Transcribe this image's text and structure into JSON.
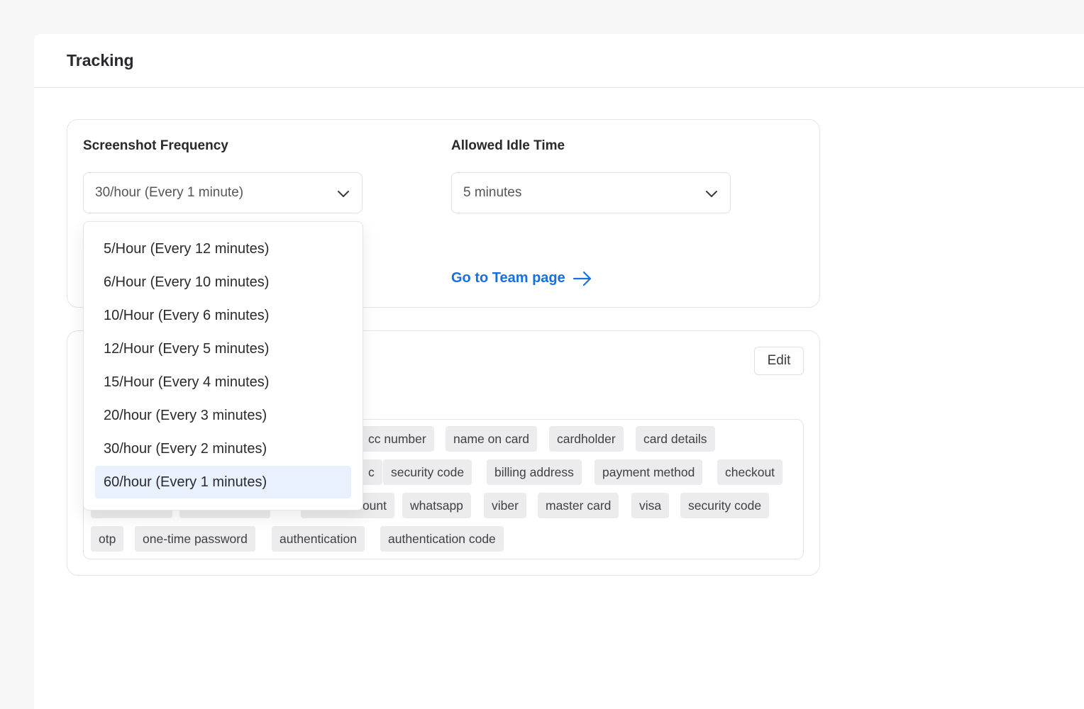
{
  "page": {
    "title": "Tracking"
  },
  "screenshot_frequency": {
    "label": "Screenshot Frequency",
    "value": "30/hour (Every 1 minute)",
    "icon": "chevron-down-icon",
    "options": [
      "5/Hour (Every 12 minutes)",
      "6/Hour (Every 10 minutes)",
      "10/Hour (Every 6 minutes)",
      "12/Hour (Every 5 minutes)",
      "15/Hour (Every 4 minutes)",
      "20/hour (Every 3 minutes)",
      "30/hour (Every 2 minutes)",
      "60/hour (Every 1 minutes)"
    ],
    "highlighted_option": "60/hour (Every 1 minutes)"
  },
  "idle_time": {
    "label": "Allowed Idle Time",
    "value": "5 minutes",
    "icon": "chevron-down-icon"
  },
  "team_link": {
    "label": "Go to Team page",
    "icon": "arrow-right-icon"
  },
  "keywords_card": {
    "edit_label": "Edit",
    "tags": [
      "cc number",
      "name on card",
      "cardholder",
      "card details",
      "c",
      "security code",
      "billing address",
      "payment method",
      "checkout",
      "ount",
      "whatsapp",
      "viber",
      "master card",
      "visa",
      "security code",
      "otp",
      "one-time password",
      "authentication",
      "authentication code"
    ]
  },
  "colors": {
    "accent": "#1a6fe0",
    "tag_bg": "#ececee",
    "selected_option_bg": "#e9f0fe",
    "border": "#e4e4e7"
  }
}
